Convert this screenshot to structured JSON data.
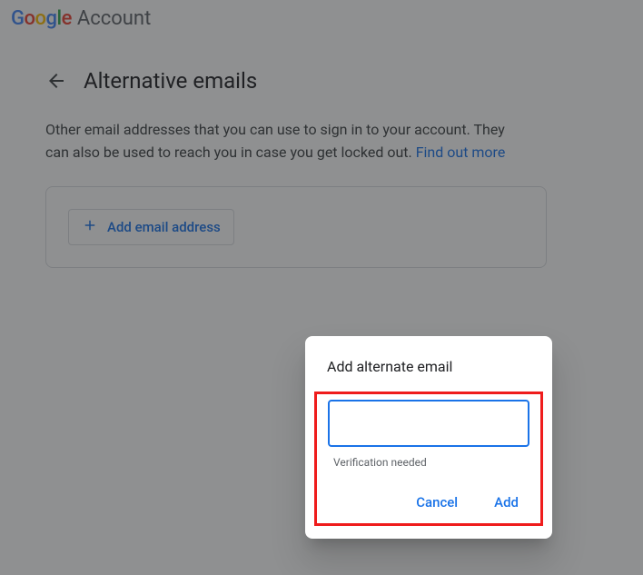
{
  "header": {
    "account_label": "Account"
  },
  "page": {
    "title": "Alternative emails",
    "description_part1": "Other email addresses that you can use to sign in to your account. They can also be used to reach you in case you get locked out. ",
    "find_out_more": "Find out more"
  },
  "card": {
    "add_label": "Add email address"
  },
  "dialog": {
    "title": "Add alternate email",
    "input_value": "",
    "helper": "Verification needed",
    "cancel": "Cancel",
    "add": "Add"
  }
}
